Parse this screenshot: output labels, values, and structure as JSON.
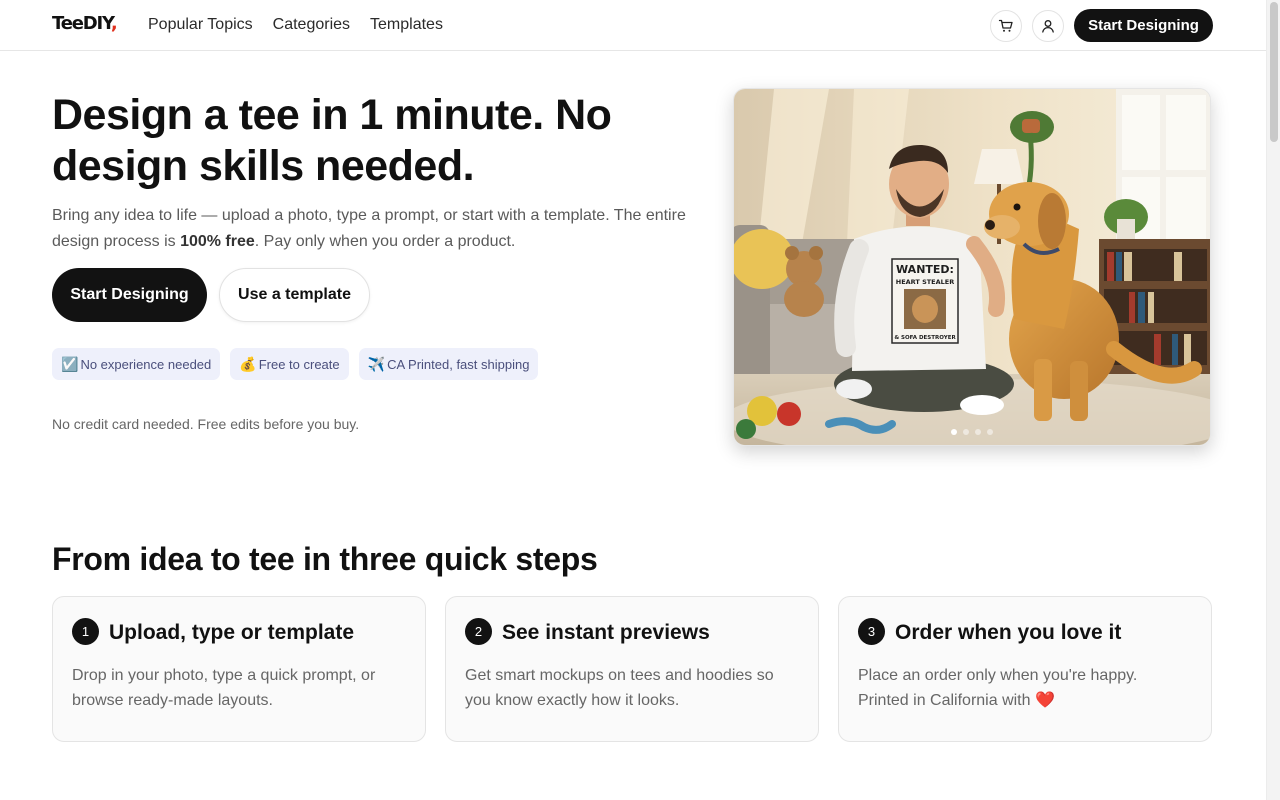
{
  "header": {
    "logo_text": "TeeDIY",
    "logo_accent": ",",
    "nav": [
      "Popular Topics",
      "Categories",
      "Templates"
    ],
    "cart_icon": "cart-icon",
    "user_icon": "user-icon",
    "cta_label": "Start Designing"
  },
  "hero": {
    "title": "Design a tee in 1 minute. No design skills needed.",
    "subtitle_pre": "Bring any idea to life — upload a photo, type a prompt, or start with a template. The entire design process is ",
    "subtitle_bold": "100% free",
    "subtitle_post": ". Pay only when you order a product.",
    "primary_button": "Start Designing",
    "secondary_button": "Use a template",
    "badges": [
      {
        "emoji": "☑️",
        "label": "No experience needed"
      },
      {
        "emoji": "💰",
        "label": "Free to create"
      },
      {
        "emoji": "✈️",
        "label": "CA Printed, fast shipping"
      }
    ],
    "note": "No credit card needed. Free edits before you buy.",
    "image": {
      "shirt_line1": "WANTED:",
      "shirt_line2": "HEART STEALER",
      "shirt_line3": "& SOFA DESTROYER",
      "carousel_total": 4,
      "carousel_active": 1
    }
  },
  "steps": {
    "title": "From idea to tee in three quick steps",
    "items": [
      {
        "num": "1",
        "title": "Upload, type or template",
        "desc": "Drop in your photo, type a quick prompt, or browse ready-made layouts."
      },
      {
        "num": "2",
        "title": "See instant previews",
        "desc": "Get smart mockups on tees and hoodies so you know exactly how it looks."
      },
      {
        "num": "3",
        "title": "Order when you love it",
        "desc": "Place an order only when you're happy. Printed in California with ❤️"
      }
    ]
  },
  "colors": {
    "dark": "#121212",
    "accent": "#e0301e",
    "badge_bg": "#eef0fb",
    "badge_text": "#4a4f7c"
  }
}
